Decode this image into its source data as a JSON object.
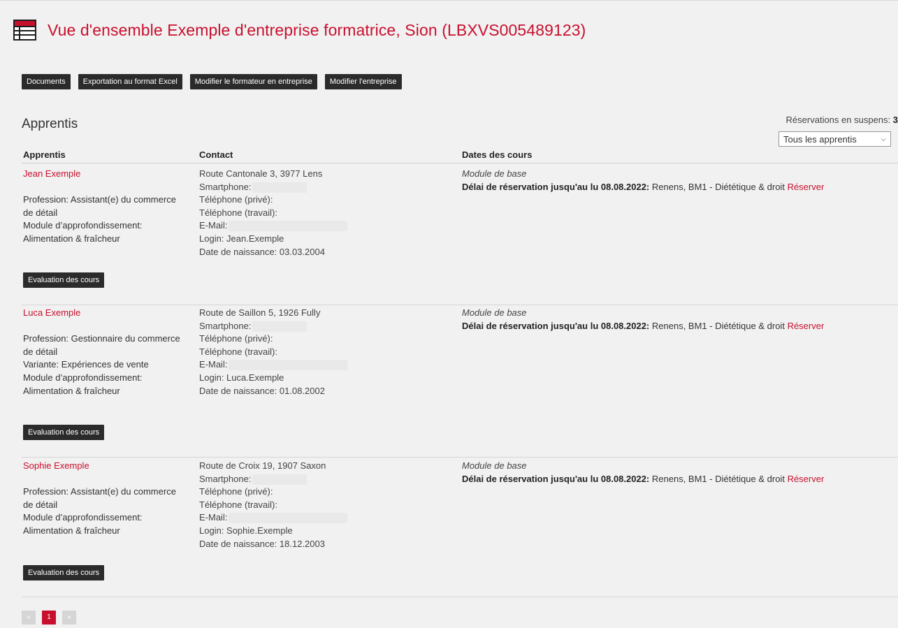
{
  "header": {
    "title": "Vue d'ensemble Exemple d'entreprise formatrice, Sion (LBXVS005489123)",
    "icon": "table-icon"
  },
  "toolbar": {
    "documents": "Documents",
    "export_excel": "Exportation au format Excel",
    "edit_trainer": "Modifier le formateur en entreprise",
    "edit_company": "Modifier l'entreprise"
  },
  "section": {
    "title": "Apprentis",
    "pending_label": "Réservations en suspens:",
    "pending_count": "3",
    "filter_value": "Tous les apprentis"
  },
  "columns": {
    "apprentice": "Apprentis",
    "contact": "Contact",
    "course_dates": "Dates des cours"
  },
  "apprentices": [
    {
      "name": "Jean Exemple",
      "details": [
        "Profession: Assistant(e) du commerce",
        "de détail",
        "Module d’approfondissement:",
        "Alimentation & fraîcheur"
      ],
      "address": "Route Cantonale 3, 3977 Lens",
      "smartphone": "Smartphone:",
      "phone_private": "Téléphone (privé):",
      "phone_work": "Téléphone (travail):",
      "email": "E-Mail:",
      "login": "Login: Jean.Exemple",
      "birthdate": "Date de naissance: 03.03.2004",
      "course_module": "Module de base",
      "deadline_label": "Délai de réservation jusqu'au lu 08.08.2022:",
      "course_text": "Renens, BM1 - Diététique & droit",
      "reserve": "Réserver",
      "eval": "Evaluation des cours"
    },
    {
      "name": "Luca Exemple",
      "details": [
        "Profession: Gestionnaire du commerce",
        "de détail",
        "Variante: Expériences de vente",
        "Module d’approfondissement:",
        "Alimentation & fraîcheur"
      ],
      "address": "Route de Saillon 5, 1926 Fully",
      "smartphone": "Smartphone:",
      "phone_private": "Téléphone (privé):",
      "phone_work": "Téléphone (travail):",
      "email": "E-Mail:",
      "login": "Login: Luca.Exemple",
      "birthdate": "Date de naissance: 01.08.2002",
      "course_module": "Module de base",
      "deadline_label": "Délai de réservation jusqu'au lu 08.08.2022:",
      "course_text": "Renens, BM1 - Diététique & droit",
      "reserve": "Réserver",
      "eval": "Evaluation des cours"
    },
    {
      "name": "Sophie Exemple",
      "details": [
        "Profession: Assistant(e) du commerce",
        "de détail",
        "Module d’approfondissement:",
        "Alimentation & fraîcheur"
      ],
      "address": "Route de Croix 19, 1907 Saxon",
      "smartphone": "Smartphone:",
      "phone_private": "Téléphone (privé):",
      "phone_work": "Téléphone (travail):",
      "email": "E-Mail:",
      "login": "Login: Sophie.Exemple",
      "birthdate": "Date de naissance: 18.12.2003",
      "course_module": "Module de base",
      "deadline_label": "Délai de réservation jusqu'au lu 08.08.2022:",
      "course_text": "Renens, BM1 - Diététique & droit",
      "reserve": "Réserver",
      "eval": "Evaluation des cours"
    }
  ],
  "pagination": {
    "prev": "«",
    "current": "1",
    "next": "»"
  },
  "colors": {
    "accent": "#c8102e",
    "button_bg": "#2b2b2b",
    "page_bg": "#f1f1f1"
  }
}
